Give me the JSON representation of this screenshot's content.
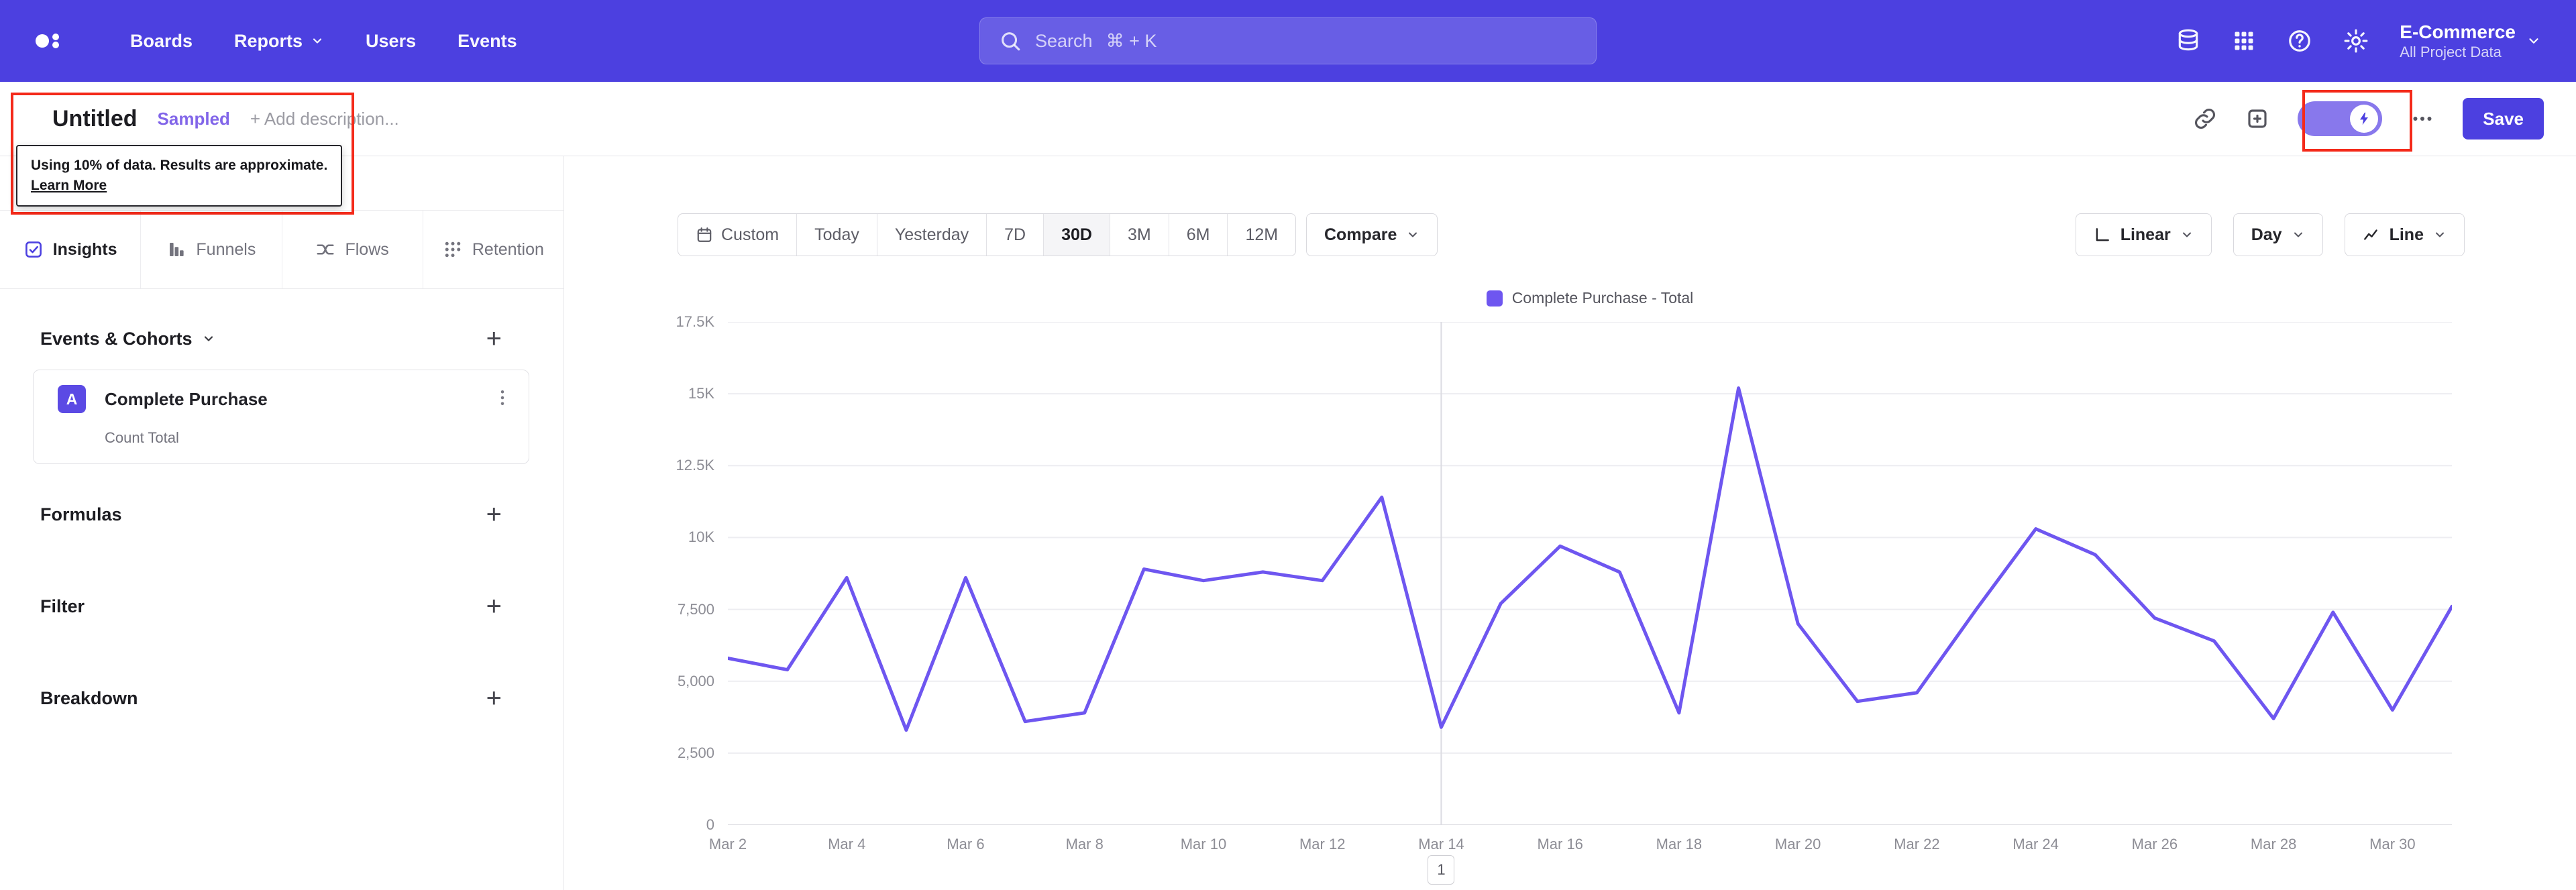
{
  "topnav": {
    "items": [
      {
        "label": "Boards"
      },
      {
        "label": "Reports",
        "has_chevron": true
      },
      {
        "label": "Users"
      },
      {
        "label": "Events"
      }
    ],
    "search": {
      "placeholder": "Search",
      "shortcut": "⌘ + K"
    },
    "icons": [
      "data-icon",
      "apps-grid-icon",
      "help-icon",
      "gear-icon"
    ],
    "project": {
      "name": "E-Commerce",
      "scope": "All Project Data"
    }
  },
  "header": {
    "title": "Untitled",
    "badge": "Sampled",
    "description_placeholder": "+ Add description...",
    "save_label": "Save"
  },
  "sampling_tooltip": {
    "text": "Using 10% of data. Results are approximate.",
    "link_label": "Learn More"
  },
  "sidebar": {
    "tabs": [
      {
        "label": "Insights"
      },
      {
        "label": "Funnels"
      },
      {
        "label": "Flows"
      },
      {
        "label": "Retention"
      }
    ],
    "active_tab": "Insights",
    "events_header": {
      "title": "Events & Cohorts"
    },
    "event_card": {
      "badge": "A",
      "name": "Complete Purchase",
      "metric": "Count Total"
    },
    "sections": [
      {
        "title": "Formulas"
      },
      {
        "title": "Filter"
      },
      {
        "title": "Breakdown"
      }
    ]
  },
  "controls": {
    "date_ranges": [
      "Custom",
      "Today",
      "Yesterday",
      "7D",
      "30D",
      "3M",
      "6M",
      "12M"
    ],
    "selected_range": "30D",
    "compare": "Compare",
    "scale": "Linear",
    "granularity": "Day",
    "chart_type": "Line"
  },
  "chart_data": {
    "type": "line",
    "title": "",
    "legend": [
      "Complete Purchase - Total"
    ],
    "legend_position": "top",
    "x": [
      "Mar 2",
      "Mar 3",
      "Mar 4",
      "Mar 5",
      "Mar 6",
      "Mar 7",
      "Mar 8",
      "Mar 9",
      "Mar 10",
      "Mar 11",
      "Mar 12",
      "Mar 13",
      "Mar 14",
      "Mar 15",
      "Mar 16",
      "Mar 17",
      "Mar 18",
      "Mar 19",
      "Mar 20",
      "Mar 21",
      "Mar 22",
      "Mar 23",
      "Mar 24",
      "Mar 25",
      "Mar 26",
      "Mar 27",
      "Mar 28",
      "Mar 29",
      "Mar 30",
      "Mar 31"
    ],
    "x_tick_labels": [
      "Mar 2",
      "Mar 4",
      "Mar 6",
      "Mar 8",
      "Mar 10",
      "Mar 12",
      "Mar 14",
      "Mar 16",
      "Mar 18",
      "Mar 20",
      "Mar 22",
      "Mar 24",
      "Mar 26",
      "Mar 28",
      "Mar 30"
    ],
    "series": [
      {
        "name": "Complete Purchase - Total",
        "color": "#6e56f0",
        "values": [
          5800,
          5400,
          8600,
          3300,
          8600,
          3600,
          3900,
          8900,
          8500,
          8800,
          8500,
          11400,
          3400,
          7700,
          9700,
          8800,
          3900,
          15200,
          7000,
          4300,
          4600,
          7500,
          10300,
          9400,
          7200,
          6400,
          3700,
          7400,
          4000,
          7600
        ]
      }
    ],
    "ylim": [
      0,
      17500
    ],
    "y_ticks": [
      {
        "value": 0,
        "label": "0"
      },
      {
        "value": 2500,
        "label": "2,500"
      },
      {
        "value": 5000,
        "label": "5,000"
      },
      {
        "value": 7500,
        "label": "7,500"
      },
      {
        "value": 10000,
        "label": "10K"
      },
      {
        "value": 12500,
        "label": "12.5K"
      },
      {
        "value": 15000,
        "label": "15K"
      },
      {
        "value": 17500,
        "label": "17.5K"
      }
    ],
    "grid": "horizontal",
    "divider_x": "Mar 14",
    "page": "1"
  },
  "colors": {
    "nav": "#4c40e0",
    "accent": "#4c40e0",
    "line": "#6e56f0",
    "badge_text": "#8266e9",
    "annotation": "#f42a1a"
  }
}
